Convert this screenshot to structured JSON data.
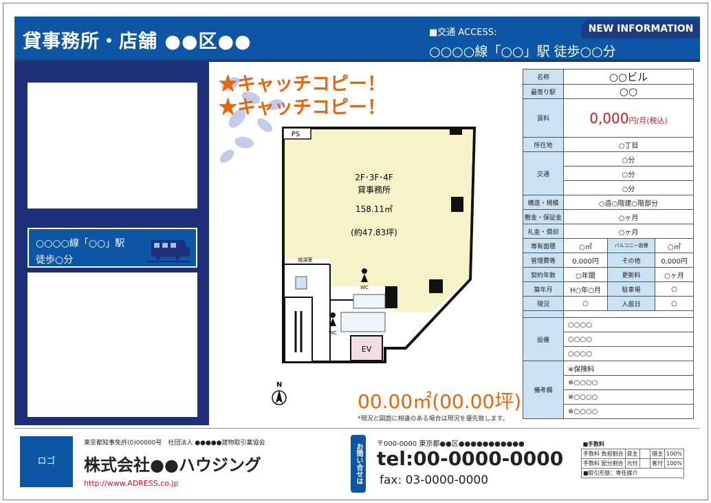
{
  "header": {
    "title": "貸事務所・店舗 ●●区●●",
    "new_info": "NEW INFORMATION",
    "access_label": "■交通 ACCESS:",
    "access_line": "○○○○線「○○」駅 徒歩○○分"
  },
  "left": {
    "station_line1": "○○○○線「○○」駅",
    "station_line2": "徒歩○分"
  },
  "catch": {
    "line1": "★キャッチコピー！",
    "line2": "★キャッチコピー！"
  },
  "plan": {
    "ps": "PS",
    "floors": "2F･3F･4F",
    "use": "貸事務所",
    "area": "158.11㎡",
    "tsubo": "(約47.83坪)",
    "kitchen": "給湯室",
    "wc1": "WC",
    "wc2": "WC",
    "ev": "EV",
    "north": "N"
  },
  "area": {
    "value": "00.00㎡(00.00坪)",
    "note": "*現況と図面に相違のある場合は現況を優先致します。"
  },
  "spec": {
    "name_lbl": "名称",
    "name": "○○ビル",
    "station_lbl": "最寄り駅",
    "station": "○○",
    "rent_lbl": "賃料",
    "rent": "0,000",
    "rent_unit": "円/月(税込)",
    "address_lbl": "所在地",
    "address": "○丁目",
    "transit_lbl": "交通",
    "transit": [
      "○分",
      "○分",
      "○分"
    ],
    "structure_lbl": "構造・規模",
    "structure": "○造○階建○階部分",
    "deposit_lbl": "敷金・保証金",
    "deposit": "○ヶ月",
    "key_lbl": "礼金・償却",
    "key": "○ヶ月",
    "area_lbl": "専有面積",
    "area": "○㎡",
    "balcony_lbl": "バルコニー面積",
    "balcony": "○㎡",
    "mgmt_lbl": "管理費等",
    "mgmt": "0,000円",
    "other_lbl": "その他",
    "other": "0,000円",
    "term_lbl": "契約年数",
    "term": "○年間",
    "renew_lbl": "更新料",
    "renew": "○ヶ月",
    "built_lbl": "築年月",
    "built": "H○年○月",
    "parking_lbl": "駐車場",
    "parking": "○",
    "status_lbl": "現況",
    "status": "○",
    "movein_lbl": "入居日",
    "movein": "○",
    "equip_lbl": "設備",
    "equip": [
      "○○○○",
      "○○○○",
      "○○○○"
    ],
    "remarks_lbl": "備考欄",
    "remarks": [
      "※保険料",
      "※○○○○",
      "※○○○○",
      "※○○○○"
    ]
  },
  "footer": {
    "logo": "ロゴ",
    "license": "東京都知事免許(0)00000号　社団法人 ●●●●●建物取引業協会",
    "company": "株式会社●●ハウジング",
    "url": "http://www.ADRESS.co.jp",
    "contact_tab": "お問い合せは",
    "address": "〒000-0000 東京都●●区●●●●●●●●●●●",
    "tel": "tel:00-0000-0000",
    "fax": "fax: 03-0000-0000"
  },
  "fee": {
    "title": "■手数料",
    "r1a": "手数料 負担割合",
    "r1b": "貸主",
    "r1c": "借主",
    "r1d": "100%",
    "r2a": "手数料 配分割合",
    "r2b": "元付",
    "r2c": "客付",
    "r2d": "100%",
    "mode": "■取引形態：専任媒介"
  },
  "colors": {
    "brand": "#0d56a5",
    "dark": "#1e2f7a",
    "accent": "#e8650c",
    "rent": "#d7141d",
    "label_bg": "#c9e3f4",
    "floor": "#f6f3c8"
  }
}
